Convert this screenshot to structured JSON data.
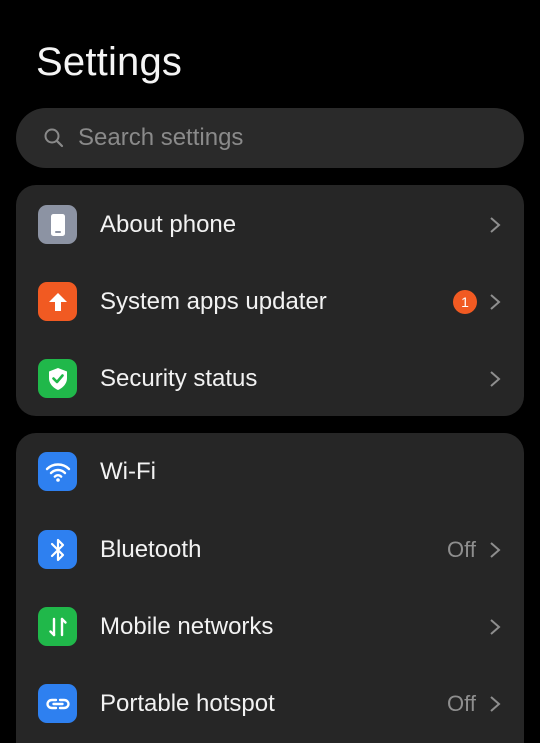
{
  "header": {
    "title": "Settings"
  },
  "search": {
    "placeholder": "Search settings"
  },
  "group1": {
    "items": [
      {
        "label": "About phone",
        "icon": "phone-icon",
        "color": "#8c93a3"
      },
      {
        "label": "System apps updater",
        "icon": "arrow-up-icon",
        "color": "#f15a22",
        "badge": "1"
      },
      {
        "label": "Security status",
        "icon": "shield-check-icon",
        "color": "#20b84a"
      }
    ]
  },
  "group2": {
    "items": [
      {
        "label": "Wi-Fi",
        "icon": "wifi-icon",
        "color": "#2e80f0"
      },
      {
        "label": "Bluetooth",
        "icon": "bluetooth-icon",
        "color": "#2e80f0",
        "value": "Off"
      },
      {
        "label": "Mobile networks",
        "icon": "mobile-data-icon",
        "color": "#20b84a"
      },
      {
        "label": "Portable hotspot",
        "icon": "hotspot-icon",
        "color": "#2e80f0",
        "value": "Off"
      }
    ]
  }
}
